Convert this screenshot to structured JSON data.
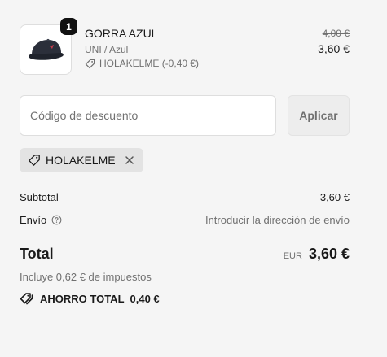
{
  "item": {
    "quantity": "1",
    "name": "GORRA AZUL",
    "variant": "UNI / Azul",
    "discount_note": "HOLAKELME (-0,40 €)",
    "price_original": "4,00 €",
    "price_final": "3,60 €",
    "image_icon": "cap-icon"
  },
  "discount": {
    "placeholder": "Código de descuento",
    "apply_label": "Aplicar",
    "applied_code": "HOLAKELME",
    "tag_icon": "tag-icon",
    "remove_icon": "close-icon"
  },
  "summary": {
    "subtotal_label": "Subtotal",
    "subtotal_value": "3,60 €",
    "shipping_label": "Envío",
    "shipping_value": "Introducir la dirección de envío",
    "total_label": "Total",
    "currency": "EUR",
    "total_value": "3,60 €",
    "tax_note": "Incluye 0,62 € de impuestos",
    "savings_label": "AHORRO TOTAL",
    "savings_value": "0,40 €"
  },
  "colors": {
    "background": "#f5f5f5",
    "text": "#1a1a1a",
    "muted": "#707070"
  }
}
